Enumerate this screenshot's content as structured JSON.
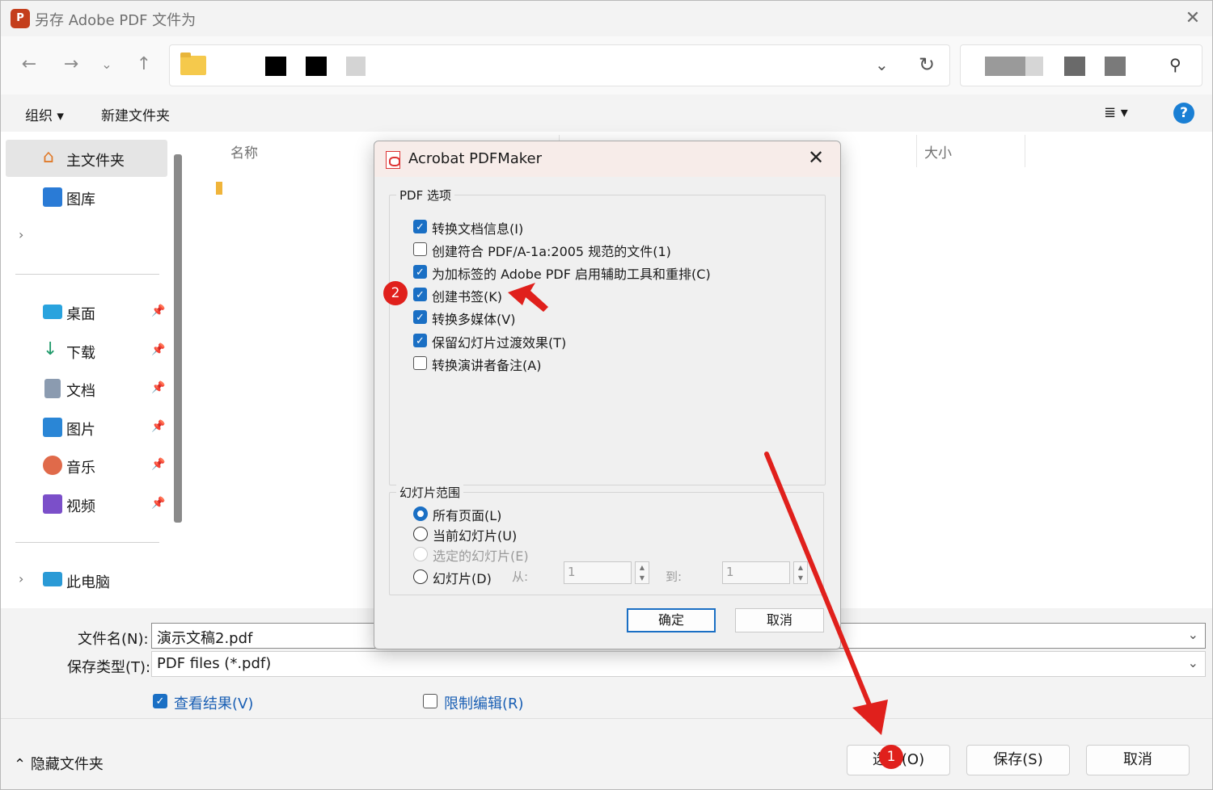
{
  "window": {
    "title": "另存 Adobe PDF 文件为",
    "app_icon_letter": "P"
  },
  "toolbar": {
    "organize": "组织 ▾",
    "new_folder": "新建文件夹",
    "view_icon": "≣ ▾",
    "help": "?"
  },
  "sidebar": {
    "items": [
      {
        "label": "主文件夹"
      },
      {
        "label": "图库"
      },
      {
        "label": "桌面"
      },
      {
        "label": "下载"
      },
      {
        "label": "文档"
      },
      {
        "label": "图片"
      },
      {
        "label": "音乐"
      },
      {
        "label": "视频"
      },
      {
        "label": "此电脑"
      }
    ]
  },
  "filelist": {
    "col_name": "名称",
    "col_size": "大小"
  },
  "form": {
    "filename_label": "文件名(N):",
    "filename_value": "演示文稿2.pdf",
    "filetype_label": "保存类型(T):",
    "filetype_value": "PDF files (*.pdf)",
    "view_result": "查看结果(V)",
    "restrict_edit": "限制编辑(R)"
  },
  "footer": {
    "hide_folders": "隐藏文件夹",
    "options_button": "选项(O)",
    "save_button": "保存(S)",
    "cancel_button": "取消"
  },
  "dialog": {
    "title": "Acrobat PDFMaker",
    "pdf_options_title": "PDF 选项",
    "options": [
      {
        "label": "转换文档信息(I)",
        "checked": true
      },
      {
        "label": "创建符合 PDF/A-1a:2005 规范的文件(1)",
        "checked": false
      },
      {
        "label": "为加标签的 Adobe PDF 启用辅助工具和重排(C)",
        "checked": true
      },
      {
        "label": "创建书签(K)",
        "checked": true
      },
      {
        "label": "转换多媒体(V)",
        "checked": true
      },
      {
        "label": "保留幻灯片过渡效果(T)",
        "checked": true
      },
      {
        "label": "转换演讲者备注(A)",
        "checked": false
      }
    ],
    "slide_range_title": "幻灯片范围",
    "radios": [
      {
        "label": "所有页面(L)"
      },
      {
        "label": "当前幻灯片(U)"
      },
      {
        "label": "选定的幻灯片(E)"
      },
      {
        "label": "幻灯片(D)"
      }
    ],
    "from_label": "从:",
    "to_label": "到:",
    "from_value": "1",
    "to_value": "1",
    "ok_button": "确定",
    "cancel_button": "取消"
  },
  "annotations": {
    "badge_1": "1",
    "badge_2": "2",
    "color": "#e0201c"
  }
}
